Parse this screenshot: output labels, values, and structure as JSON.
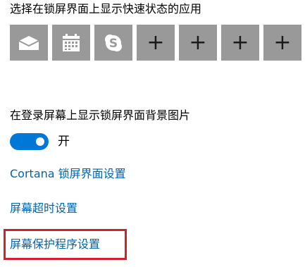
{
  "quick_status": {
    "heading": "选择在锁屏界面上显示快速状态的应用",
    "tiles": [
      {
        "icon": "mail-icon",
        "kind": "app"
      },
      {
        "icon": "calendar-icon",
        "kind": "app"
      },
      {
        "icon": "skype-icon",
        "kind": "app"
      },
      {
        "icon": "plus-icon",
        "kind": "add",
        "glyph": "+"
      },
      {
        "icon": "plus-icon",
        "kind": "add",
        "glyph": "+"
      },
      {
        "icon": "plus-icon",
        "kind": "add",
        "glyph": "+"
      },
      {
        "icon": "plus-icon",
        "kind": "add",
        "glyph": "+"
      }
    ]
  },
  "background": {
    "heading": "在登录屏幕上显示锁屏界面背景图片",
    "toggle_state": "开",
    "toggle_on": true
  },
  "links": {
    "cortana": "Cortana 锁屏界面设置",
    "timeout": "屏幕超时设置",
    "screensaver": "屏幕保护程序设置"
  },
  "colors": {
    "accent": "#0078d7",
    "link": "#0063b1",
    "tile": "#999999",
    "highlight": "#d0222b"
  }
}
